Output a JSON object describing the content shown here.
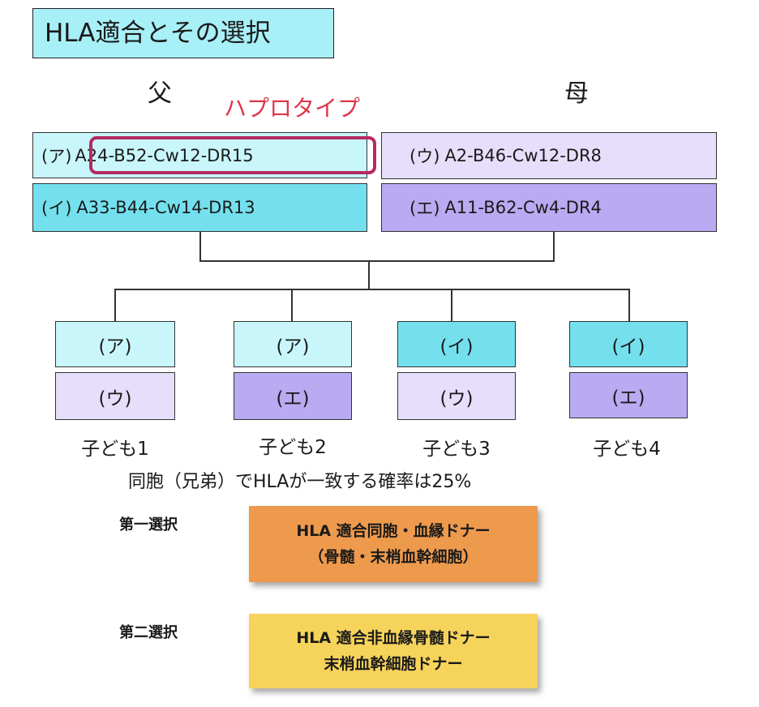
{
  "title": "HLA適合とその選択",
  "father_label": "父",
  "mother_label": "母",
  "haplotype_label": "ハプロタイプ",
  "father": [
    {
      "prefix": "(ア)",
      "value": "A24-B52-Cw12-DR15"
    },
    {
      "prefix": "(イ)",
      "value": "A33-B44-Cw14-DR13"
    }
  ],
  "mother": [
    {
      "prefix": "(ウ)",
      "value": "A2-B46-Cw12-DR8"
    },
    {
      "prefix": "(エ)",
      "value": "A11-B62-Cw4-DR4"
    }
  ],
  "children": [
    {
      "top": "(ア)",
      "bottom": "(ウ)",
      "label": "子ども1"
    },
    {
      "top": "(ア)",
      "bottom": "(エ)",
      "label": "子ども2"
    },
    {
      "top": "(イ)",
      "bottom": "(ウ)",
      "label": "子ども3"
    },
    {
      "top": "(イ)",
      "bottom": "(エ)",
      "label": "子ども4"
    }
  ],
  "probability_text": "同胞（兄弟）でHLAが一致する確率は25%",
  "selections": [
    {
      "label": "第一選択",
      "line1": "HLA 適合同胞・血縁ドナー",
      "line2": "（骨髄・末梢血幹細胞）",
      "color": "#ee9a4d"
    },
    {
      "label": "第二選択",
      "line1": "HLA 適合非血縁骨髄ドナー",
      "line2": "末梢血幹細胞ドナー",
      "color": "#f6d35a"
    }
  ]
}
